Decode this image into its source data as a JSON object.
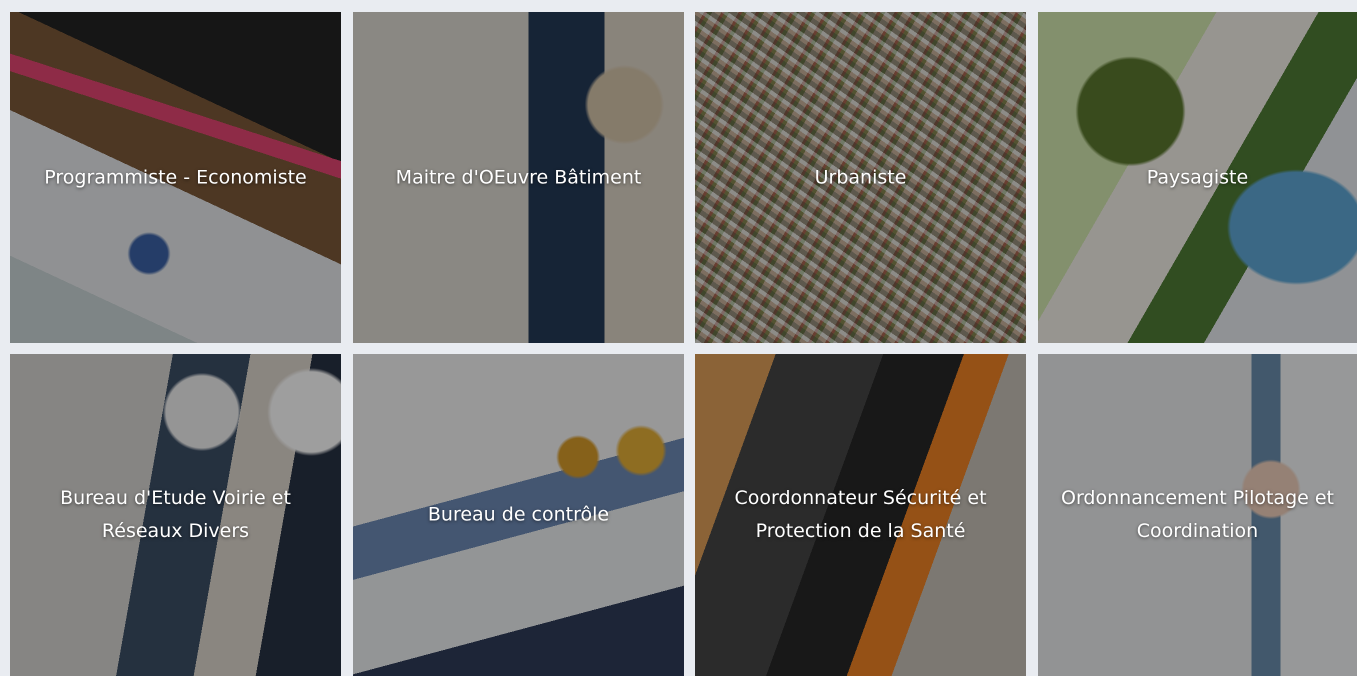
{
  "tiles": [
    {
      "title": "Programmiste - Economiste",
      "lines": [
        "Programmiste - Economiste"
      ]
    },
    {
      "title": "Maitre d'OEuvre Bâtiment",
      "lines": [
        "Maitre d'OEuvre Bâtiment"
      ]
    },
    {
      "title": "Urbaniste",
      "lines": [
        "Urbaniste"
      ]
    },
    {
      "title": "Paysagiste",
      "lines": [
        "Paysagiste"
      ]
    },
    {
      "title": "Bureau d'Etude Voirie et Réseaux Divers",
      "lines": [
        "Bureau d'Etude Voirie et",
        "Réseaux Divers"
      ]
    },
    {
      "title": "Bureau de contrôle",
      "lines": [
        "Bureau de contrôle"
      ]
    },
    {
      "title": "Coordonnateur Sécurité et Protection de la Santé",
      "lines": [
        "Coordonnateur Sécurité et",
        "Protection de la Santé"
      ]
    },
    {
      "title": "Ordonnancement Pilotage et Coordination",
      "lines": [
        "Ordonnancement Pilotage et",
        "Coordination"
      ]
    }
  ]
}
